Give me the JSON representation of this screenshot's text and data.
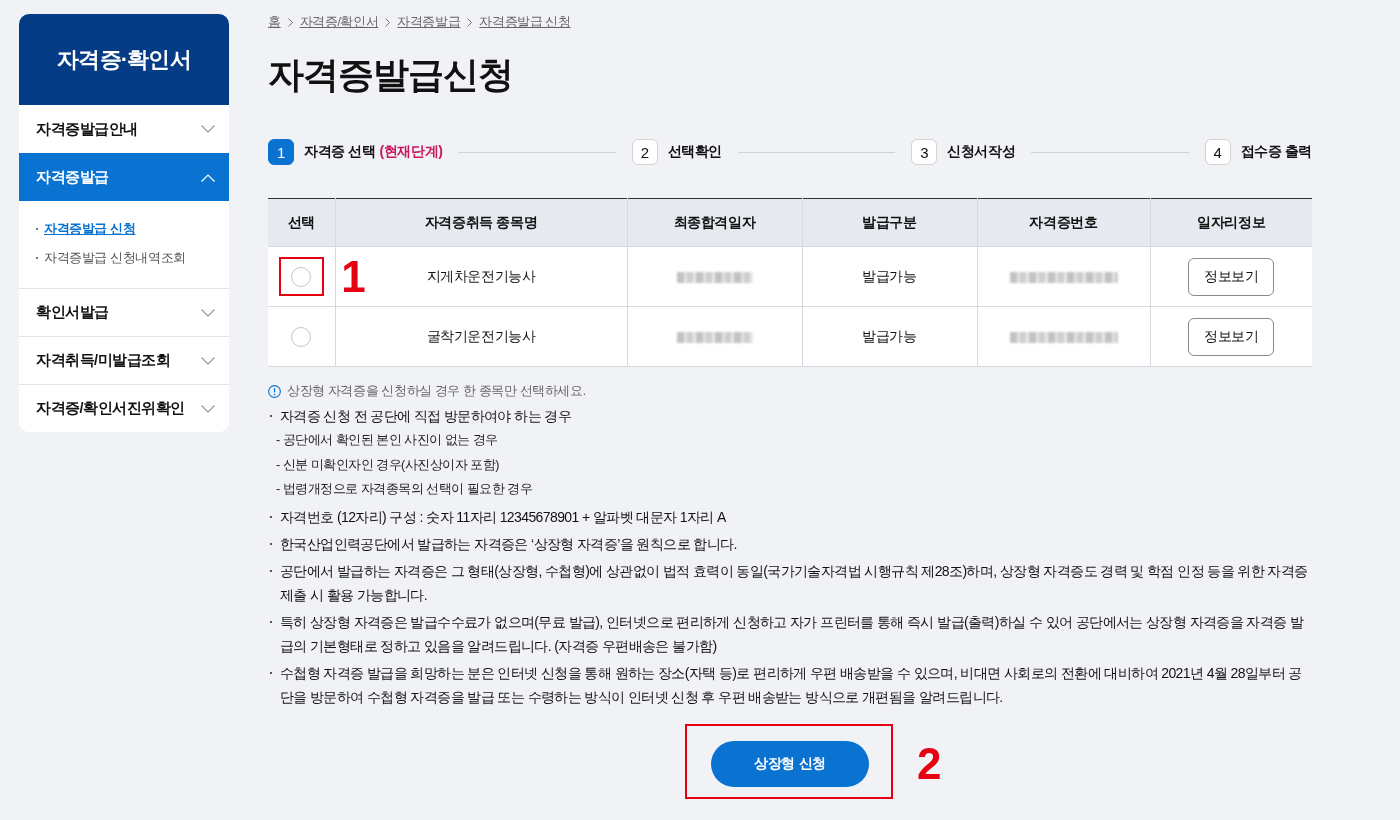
{
  "sidebar": {
    "title": "자격증·확인서",
    "items": [
      {
        "label": "자격증발급안내",
        "selected": false,
        "expanded": false
      },
      {
        "label": "자격증발급",
        "selected": true,
        "expanded": true,
        "children": [
          {
            "label": "자격증발급 신청",
            "selected": true
          },
          {
            "label": "자격증발급 신청내역조회",
            "selected": false
          }
        ]
      },
      {
        "label": "확인서발급",
        "selected": false,
        "expanded": false
      },
      {
        "label": "자격취득/미발급조회",
        "selected": false,
        "expanded": false
      },
      {
        "label": "자격증/확인서진위확인",
        "selected": false,
        "expanded": false
      }
    ]
  },
  "breadcrumb": [
    "홈",
    "자격증/확인서",
    "자격증발급",
    "자격증발급 신청"
  ],
  "page_title": "자격증발급신청",
  "steps": [
    {
      "number": "1",
      "label": "자격증 선택",
      "status": "(현재단계)",
      "selected": true
    },
    {
      "number": "2",
      "label": "선택확인",
      "selected": false
    },
    {
      "number": "3",
      "label": "신청서작성",
      "selected": false
    },
    {
      "number": "4",
      "label": "접수증 출력",
      "selected": false
    }
  ],
  "table": {
    "columns": [
      "선택",
      "자격증취득 종목명",
      "최종합격일자",
      "발급구분",
      "자격증번호",
      "일자리정보"
    ],
    "rows": [
      {
        "callout": "1",
        "cells": [
          {
            "kind": "radio",
            "selected": false
          },
          {
            "kind": "text",
            "text": "지게차운전기능사"
          },
          {
            "kind": "redacted"
          },
          {
            "kind": "text",
            "text": "발급가능"
          },
          {
            "kind": "redacted"
          },
          {
            "kind": "button",
            "label": "정보보기"
          }
        ]
      },
      {
        "cells": [
          {
            "kind": "radio",
            "selected": false
          },
          {
            "kind": "text",
            "text": "굴착기운전기능사"
          },
          {
            "kind": "redacted"
          },
          {
            "kind": "text",
            "text": "발급가능"
          },
          {
            "kind": "redacted"
          },
          {
            "kind": "button",
            "label": "정보보기"
          }
        ]
      }
    ]
  },
  "notice": "상장형 자격증을 신청하실 경우 한 종목만 선택하세요.",
  "notes": [
    {
      "text": "자격증 신청 전 공단에 직접 방문하여야 하는 경우",
      "children": [
        {
          "text": "- 공단에서 확인된 본인 사진이 없는 경우"
        },
        {
          "text": "- 신분 미확인자인 경우(사진상이자 포함)"
        },
        {
          "text": "- 법령개정으로 자격종목의 선택이 필요한 경우"
        }
      ]
    },
    {
      "text": "자격번호 (12자리) 구성 : 숫자 11자리 12345678901 + 알파벳 대문자 1자리 A"
    },
    {
      "text": "한국산업인력공단에서 발급하는 자격증은 ‘상장형 자격증’을 원칙으로 합니다."
    },
    {
      "text": "공단에서 발급하는 자격증은 그 형태(상장형, 수첩형)에 상관없이 법적 효력이 동일(국가기술자격법 시행규칙 제28조)하며, 상장형 자격증도 경력 및 학점 인정 등을 위한 자격증 제출 시 활용 가능합니다."
    },
    {
      "text": "특히 상장형 자격증은 발급수수료가 없으며(무료 발급), 인터넷으로 편리하게 신청하고 자가 프린터를 통해 즉시 발급(출력)하실 수 있어 공단에서는 상장형 자격증을 자격증 발급의 기본형태로 정하고 있음을 알려드립니다. (자격증 우편배송은 불가함)"
    },
    {
      "text": "수첩형 자격증 발급을 희망하는 분은 인터넷 신청을 통해 원하는 장소(자택 등)로 편리하게 우편 배송받을 수 있으며, 비대면 사회로의 전환에 대비하여 2021년 4월 28일부터 공단을 방문하여 수첩형 자격증을 발급 또는 수령하는 방식이 인터넷 신청 후 우편 배송받는 방식으로 개편됨을 알려드립니다."
    }
  ],
  "submit_button": {
    "label": "상장형 신청",
    "callout": "2"
  }
}
